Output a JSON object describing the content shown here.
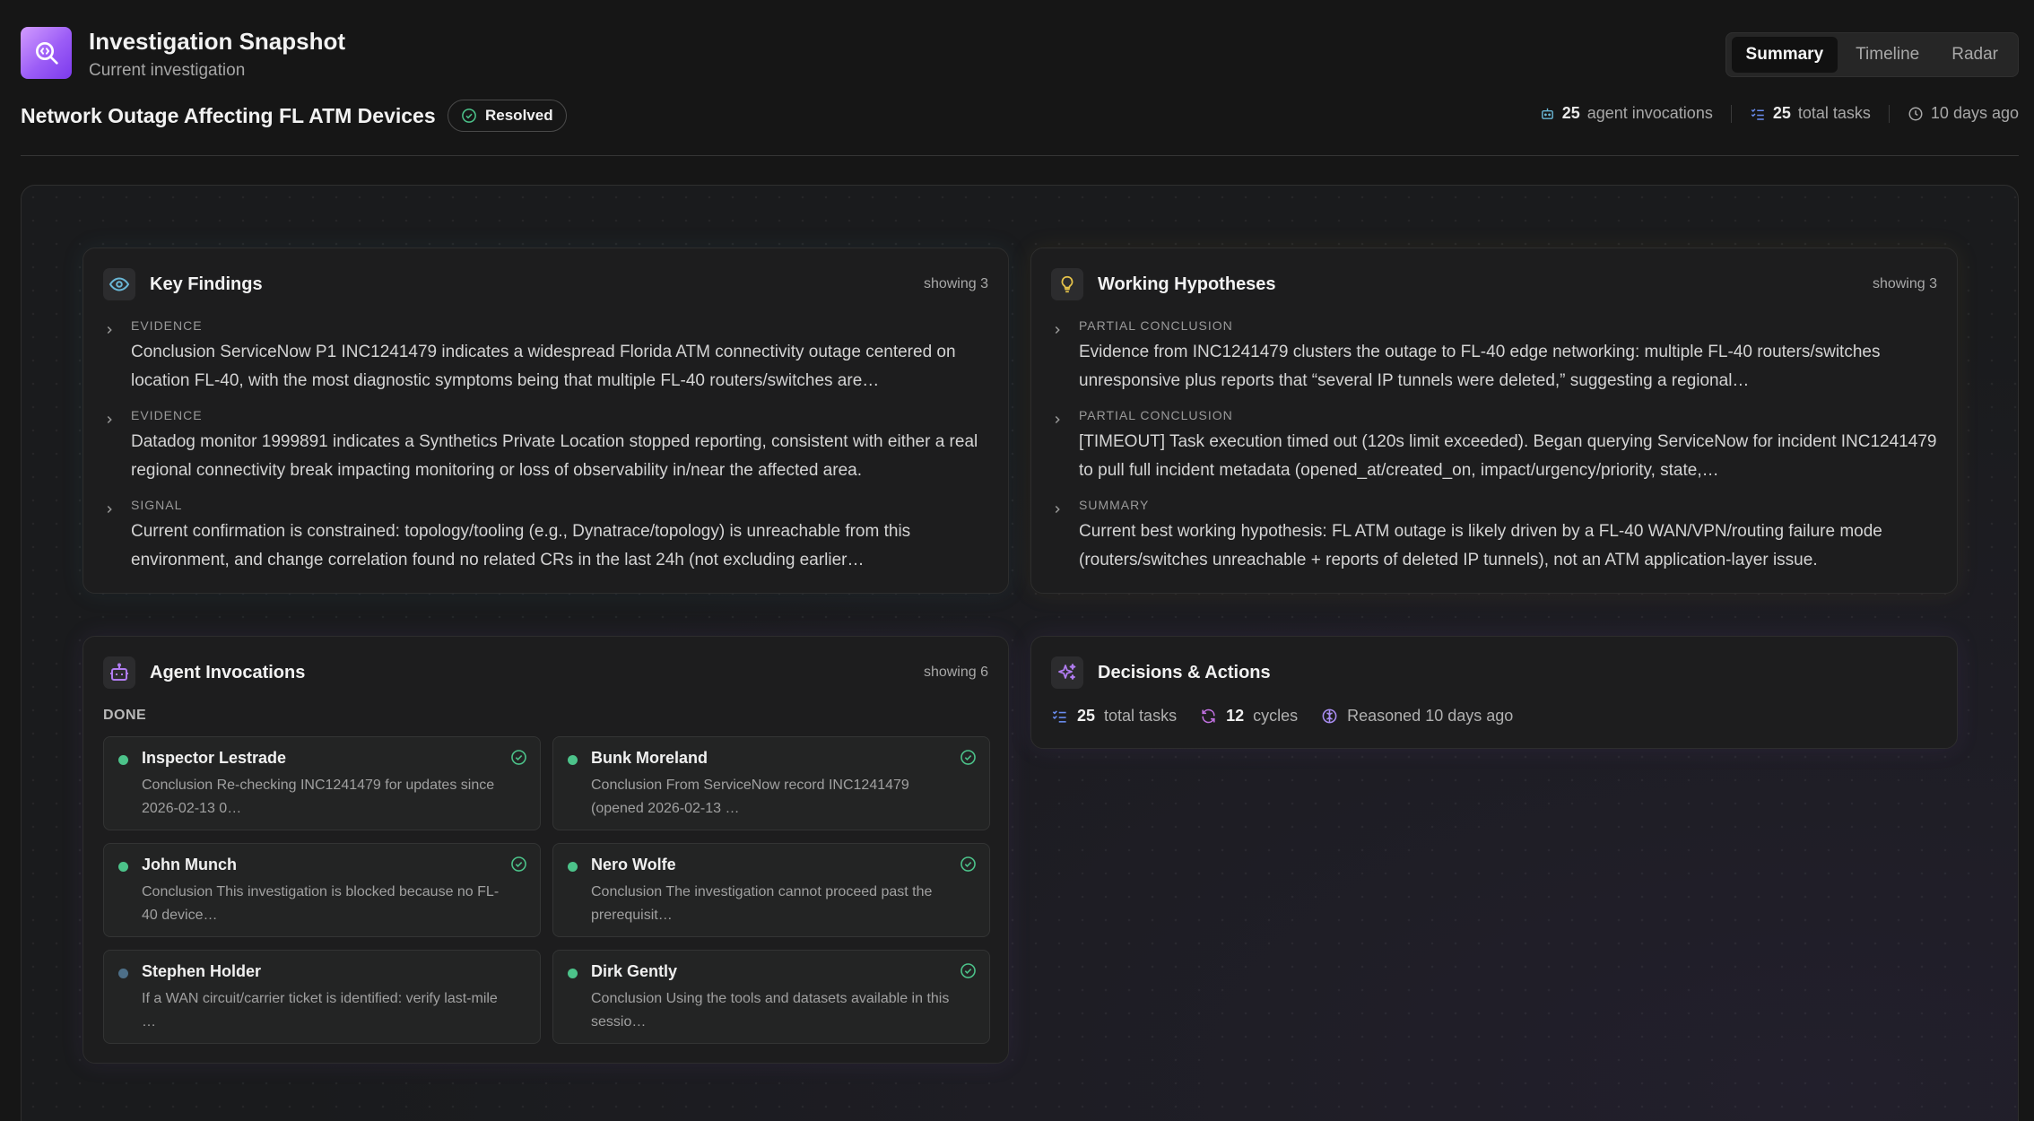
{
  "header": {
    "app_title": "Investigation Snapshot",
    "app_subtitle": "Current investigation",
    "tabs": [
      {
        "label": "Summary",
        "active": true
      },
      {
        "label": "Timeline",
        "active": false
      },
      {
        "label": "Radar",
        "active": false
      }
    ]
  },
  "investigation": {
    "title": "Network Outage Affecting FL ATM Devices",
    "status": "Resolved",
    "agent_invocations_count": "25",
    "agent_invocations_label": "agent invocations",
    "total_tasks_count": "25",
    "total_tasks_label": "total tasks",
    "age": "10 days ago"
  },
  "key_findings": {
    "title": "Key Findings",
    "count_label": "showing 3",
    "items": [
      {
        "kind": "Evidence",
        "text": "Conclusion ServiceNow P1 INC1241479 indicates a widespread Florida ATM connectivity outage centered on location FL-40, with the most diagnostic symptoms being that multiple FL-40 routers/switches are…"
      },
      {
        "kind": "Evidence",
        "text": "Datadog monitor 1999891 indicates a Synthetics Private Location stopped reporting, consistent with either a real regional connectivity break impacting monitoring or loss of observability in/near the affected area."
      },
      {
        "kind": "Signal",
        "text": "Current confirmation is constrained: topology/tooling (e.g., Dynatrace/topology) is unreachable from this environment, and change correlation found no related CRs in the last 24h (not excluding earlier…"
      }
    ]
  },
  "working_hypotheses": {
    "title": "Working Hypotheses",
    "count_label": "showing 3",
    "items": [
      {
        "kind": "Partial conclusion",
        "text": "Evidence from INC1241479 clusters the outage to FL-40 edge networking: multiple FL-40 routers/switches unresponsive plus reports that “several IP tunnels were deleted,” suggesting a regional…"
      },
      {
        "kind": "Partial conclusion",
        "text": "[TIMEOUT] Task execution timed out (120s limit exceeded). Began querying ServiceNow for incident INC1241479 to pull full incident metadata (opened_at/created_on, impact/urgency/priority, state,…"
      },
      {
        "kind": "Summary",
        "text": "Current best working hypothesis: FL ATM outage is likely driven by a FL-40 WAN/VPN/routing failure mode (routers/switches unreachable + reports of deleted IP tunnels), not an ATM application-layer issue."
      }
    ]
  },
  "agent_invocations": {
    "title": "Agent Invocations",
    "count_label": "showing 6",
    "group_label": "DONE",
    "agents": [
      {
        "name": "Inspector Lestrade",
        "text": "Conclusion Re-checking INC1241479 for updates since 2026-02-13 0…",
        "done": true
      },
      {
        "name": "Bunk Moreland",
        "text": "Conclusion From ServiceNow record INC1241479 (opened 2026-02-13 …",
        "done": true
      },
      {
        "name": "John Munch",
        "text": "Conclusion This investigation is blocked because no FL-40 device…",
        "done": true
      },
      {
        "name": "Nero Wolfe",
        "text": "Conclusion The investigation cannot proceed past the prerequisit…",
        "done": true
      },
      {
        "name": "Stephen Holder",
        "text": "If a WAN circuit/carrier ticket is identified: verify last-mile …",
        "done": false
      },
      {
        "name": "Dirk Gently",
        "text": "Conclusion Using the tools and datasets available in this sessio…",
        "done": true
      }
    ]
  },
  "decisions": {
    "title": "Decisions & Actions",
    "tasks_count": "25",
    "tasks_label": "total tasks",
    "cycles_count": "12",
    "cycles_label": "cycles",
    "reasoned_label": "Reasoned 10 days ago"
  },
  "colors": {
    "accent_purple": "#9b5cf6",
    "success_green": "#4cc38a",
    "pending_blue": "#4d6f88",
    "findings_teal": "#6ab7d6",
    "hypotheses_yellow": "#e6c34a"
  }
}
